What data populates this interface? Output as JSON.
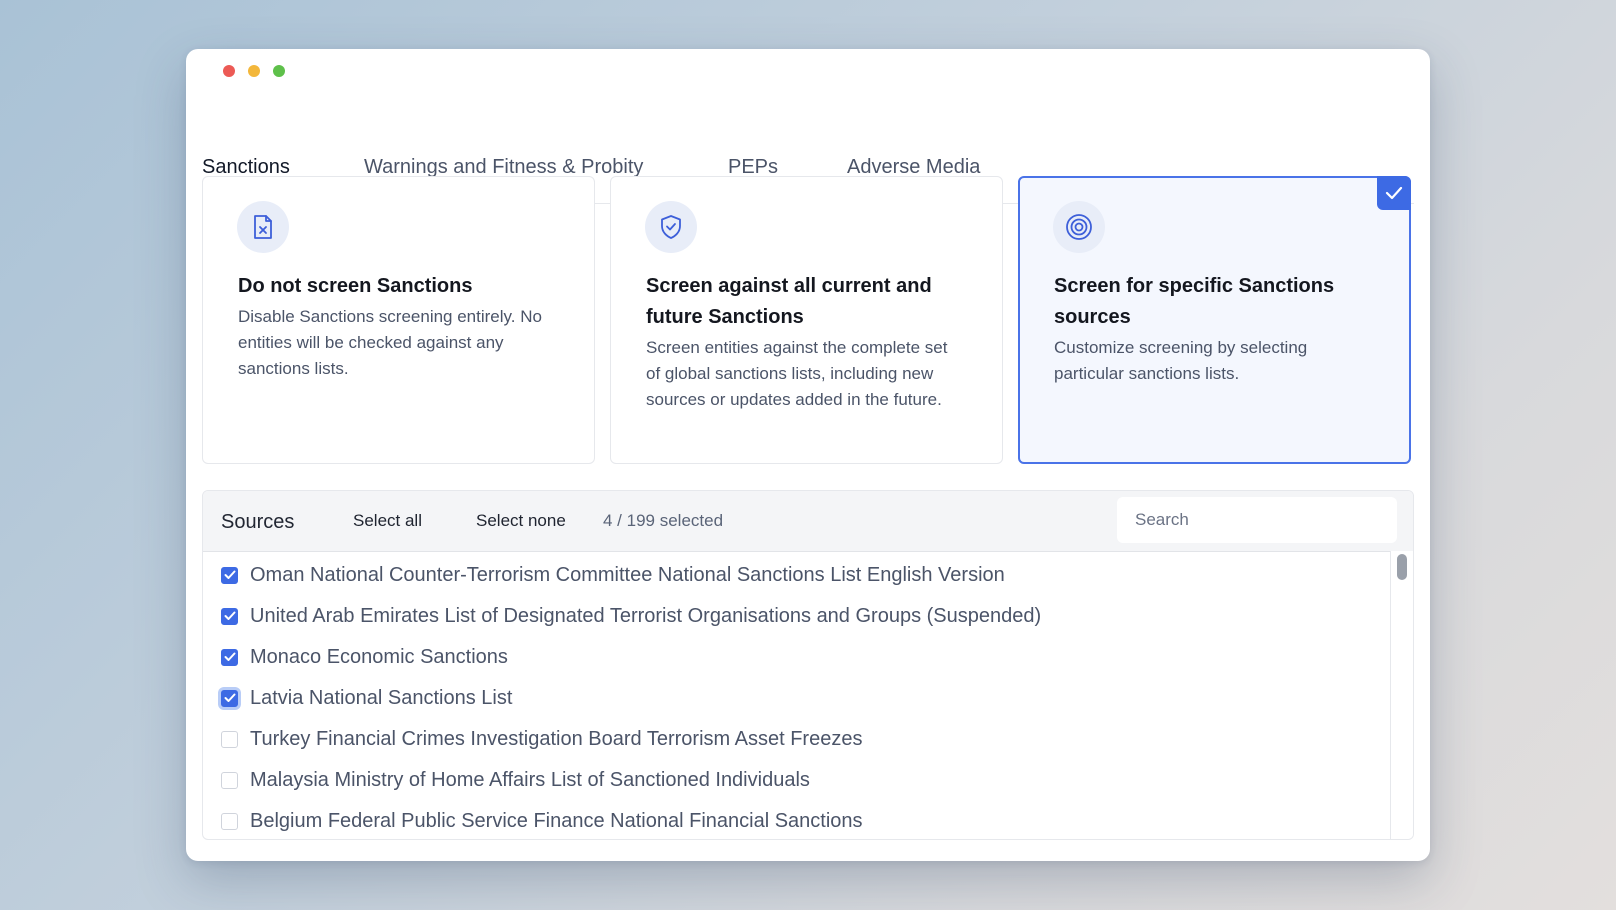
{
  "tabs": [
    {
      "label": "Sanctions",
      "active": true
    },
    {
      "label": "Warnings and Fitness & Probity"
    },
    {
      "label": "PEPs"
    },
    {
      "label": "Adverse Media"
    }
  ],
  "options": [
    {
      "title": "Do not screen Sanctions",
      "description": "Disable Sanctions screening entirely. No entities will be checked against any sanctions lists.",
      "icon": "file-x-icon",
      "selected": false
    },
    {
      "title": "Screen against all current and future Sanctions",
      "description": "Screen entities against the complete set of global sanctions lists, including new sources or updates added in the future.",
      "icon": "shield-check-icon",
      "selected": false
    },
    {
      "title": "Screen for specific Sanctions sources",
      "description": "Customize screening by selecting particular sanctions lists.",
      "icon": "target-icon",
      "selected": true
    }
  ],
  "sources": {
    "title": "Sources",
    "select_all": "Select all",
    "select_none": "Select none",
    "count": "4 / 199 selected",
    "search_placeholder": "Search",
    "items": [
      {
        "label": "Oman National Counter-Terrorism Committee National Sanctions List English Version",
        "checked": true
      },
      {
        "label": "United Arab Emirates List of Designated Terrorist Organisations and Groups (Suspended)",
        "checked": true
      },
      {
        "label": "Monaco Economic Sanctions",
        "checked": true
      },
      {
        "label": "Latvia National Sanctions List",
        "checked": true,
        "focused": true
      },
      {
        "label": "Turkey Financial Crimes Investigation Board Terrorism Asset Freezes",
        "checked": false
      },
      {
        "label": "Malaysia Ministry of Home Affairs List of Sanctioned Individuals",
        "checked": false
      },
      {
        "label": "Belgium Federal Public Service Finance National Financial Sanctions",
        "checked": false
      }
    ]
  },
  "colors": {
    "accent": "#3d6ae4",
    "tab_underline": "#2f3fce"
  }
}
